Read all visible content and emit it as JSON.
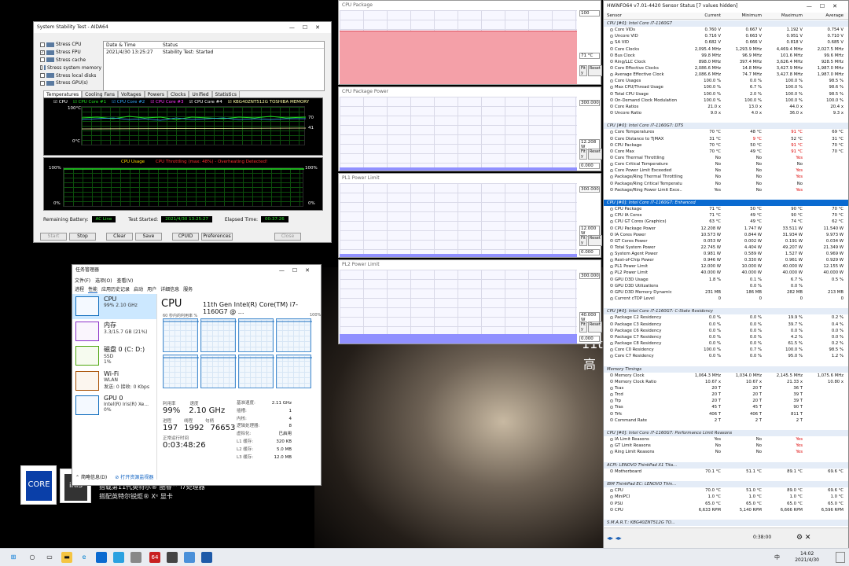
{
  "desktop": {
    "promo_line1": "11th",
    "promo_line2": "高",
    "caption1": "搭载第11代英特尔® 酷睿™ i7处理器",
    "caption2": "搭配英特尔锐炬® Xᵉ 显卡",
    "badge_core": "CORE",
    "badge_iris": "iRIS"
  },
  "aida": {
    "title": "System Stability Test - AIDA64",
    "options": [
      {
        "label": "Stress CPU",
        "checked": false
      },
      {
        "label": "Stress FPU",
        "checked": true
      },
      {
        "label": "Stress cache",
        "checked": false
      },
      {
        "label": "Stress system memory",
        "checked": false
      },
      {
        "label": "Stress local disks",
        "checked": false
      },
      {
        "label": "Stress GPU(s)",
        "checked": false
      }
    ],
    "log_headers": [
      "Date & Time",
      "Status"
    ],
    "log_rows": [
      [
        "2021/4/30 13:25:27",
        "Stability Test: Started"
      ]
    ],
    "tabs": [
      "Temperatures",
      "Cooling Fans",
      "Voltages",
      "Powers",
      "Clocks",
      "Unified",
      "Statistics"
    ],
    "legend": [
      "CPU",
      "CPU Core #1",
      "CPU Core #2",
      "CPU Core #3",
      "CPU Core #4",
      "KBG40ZNT512G TOSHIBA MEMORY"
    ],
    "legend_colors": [
      "#ffffff",
      "#22dd22",
      "#33aaff",
      "#ff33ff",
      "#ffffff",
      "#ffffaa"
    ],
    "temp_top": "100°C",
    "temp_bottom": "0°C",
    "temp_r1": "70",
    "temp_r2": "41",
    "usage_title": "CPU Usage",
    "throttle_text": "CPU Throttling (max: 48%) - Overheating Detected!",
    "usage_top_l": "100%",
    "usage_top_r": "100%",
    "usage_bot_l": "0%",
    "usage_bot_r": "0%",
    "remaining_label": "Remaining Battery:",
    "remaining_value": "AC Line",
    "started_label": "Test Started:",
    "started_value": "2021/4/30 13:25:27",
    "elapsed_label": "Elapsed Time:",
    "elapsed_value": "00:37:26",
    "buttons": [
      "Start",
      "Stop",
      "Clear",
      "Save",
      "CPUID",
      "Preferences",
      "Close"
    ]
  },
  "taskmgr": {
    "title": "任务管理器",
    "menu": [
      "文件(F)",
      "选项(O)",
      "查看(V)"
    ],
    "tabs": [
      "进程",
      "性能",
      "应用历史记录",
      "启动",
      "用户",
      "详细信息",
      "服务"
    ],
    "side": [
      {
        "name": "CPU",
        "detail1": "99% 2.10 GHz",
        "detail2": ""
      },
      {
        "name": "内存",
        "detail1": "3.3/15.7 GB (21%)",
        "detail2": ""
      },
      {
        "name": "磁盘 0 (C: D:)",
        "detail1": "SSD",
        "detail2": "1%"
      },
      {
        "name": "Wi-Fi",
        "detail1": "WLAN",
        "detail2": "发送: 0 接收: 0 Kbps"
      },
      {
        "name": "GPU 0",
        "detail1": "Intel(R) Iris(R) Xe...",
        "detail2": "0%"
      }
    ],
    "heading": "CPU",
    "cpu_name": "11th Gen Intel(R) Core(TM) i7-1160G7 @ ...",
    "graph_label": "60 秒内的利用率 %",
    "graph_max": "100%",
    "stat_labels1": [
      "利用率",
      "速度"
    ],
    "stat_values1": [
      "99%",
      "2.10 GHz"
    ],
    "stat_labels2": [
      "进程",
      "线程",
      "句柄"
    ],
    "stat_values2": [
      "197",
      "1992",
      "76653"
    ],
    "uptime_label": "正常运行时间",
    "uptime": "0:03:48:26",
    "specs": [
      [
        "基准速度:",
        "2.11 GHz"
      ],
      [
        "插槽:",
        "1"
      ],
      [
        "内核:",
        "4"
      ],
      [
        "逻辑处理器:",
        "8"
      ],
      [
        "虚拟化:",
        "已启用"
      ],
      [
        "L1 缓存:",
        "320 KB"
      ],
      [
        "L2 缓存:",
        "5.0 MB"
      ],
      [
        "L3 缓存:",
        "12.0 MB"
      ]
    ],
    "footer_less": "简略信息(D)",
    "footer_monitor": "打开资源监视器"
  },
  "graphs": [
    {
      "title": "CPU Package",
      "max": "100",
      "current": "71 °C",
      "zero": "0",
      "fill": "#f4a0a8",
      "level": 0.72
    },
    {
      "title": "CPU Package Power",
      "max": "300.000",
      "current": "12.208 W",
      "zero": "0.000",
      "fill": "#9090ff",
      "level": 0.04
    },
    {
      "title": "PL1 Power Limit",
      "max": "300.000",
      "current": "12.000 W",
      "zero": "0.000",
      "fill": "#9090ff",
      "level": 0.04
    },
    {
      "title": "PL2 Power Limit",
      "max": "300.000",
      "current": "40.000 W",
      "zero": "0.000",
      "fill": "#9090ff",
      "level": 0.133
    }
  ],
  "graph_buttons": [
    "Fit y",
    "Reset"
  ],
  "hwinfo": {
    "title": "HWiNFO64 v7.01-4420 Sensor Status [7 values hidden]",
    "headers": [
      "Sensor",
      "Current",
      "Minimum",
      "Maximum",
      "Average"
    ],
    "rows": [
      {
        "t": "g",
        "name": "CPU [#0]: Intel Core i7-1160G7"
      },
      {
        "name": "Core VIDs",
        "v": [
          "0.760 V",
          "0.667 V",
          "1.192 V",
          "0.754 V"
        ]
      },
      {
        "name": "Uncore VID",
        "v": [
          "0.716 V",
          "0.663 V",
          "0.951 V",
          "0.710 V"
        ]
      },
      {
        "name": "SA VID",
        "v": [
          "0.682 V",
          "0.666 V",
          "0.818 V",
          "0.685 V"
        ]
      },
      {
        "name": "Core Clocks",
        "v": [
          "2,095.4 MHz",
          "1,293.9 MHz",
          "4,469.4 MHz",
          "2,027.5 MHz"
        ]
      },
      {
        "name": "Bus Clock",
        "v": [
          "99.8 MHz",
          "96.9 MHz",
          "101.6 MHz",
          "99.6 MHz"
        ]
      },
      {
        "name": "Ring/LLC Clock",
        "v": [
          "898.0 MHz",
          "397.4 MHz",
          "3,626.4 MHz",
          "928.5 MHz"
        ]
      },
      {
        "name": "Core Effective Clocks",
        "v": [
          "2,086.6 MHz",
          "14.8 MHz",
          "3,427.9 MHz",
          "1,987.0 MHz"
        ]
      },
      {
        "name": "Average Effective Clock",
        "v": [
          "2,086.6 MHz",
          "74.7 MHz",
          "3,427.8 MHz",
          "1,987.0 MHz"
        ]
      },
      {
        "name": "Core Usages",
        "v": [
          "100.0 %",
          "0.0 %",
          "100.0 %",
          "98.5 %"
        ]
      },
      {
        "name": "Max CPU/Thread Usage",
        "v": [
          "100.0 %",
          "6.7 %",
          "100.0 %",
          "98.6 %"
        ]
      },
      {
        "name": "Total CPU Usage",
        "v": [
          "100.0 %",
          "2.0 %",
          "100.0 %",
          "98.5 %"
        ]
      },
      {
        "name": "On-Demand Clock Modulation",
        "v": [
          "100.0 %",
          "100.0 %",
          "100.0 %",
          "100.0 %"
        ]
      },
      {
        "name": "Core Ratios",
        "v": [
          "21.0 x",
          "13.0 x",
          "44.0 x",
          "20.4 x"
        ]
      },
      {
        "name": "Uncore Ratio",
        "v": [
          "9.0 x",
          "4.0 x",
          "36.0 x",
          "9.3 x"
        ]
      },
      {
        "t": "s"
      },
      {
        "t": "g",
        "name": "CPU [#0]: Intel Core i7-1160G7: DTS"
      },
      {
        "name": "Core Temperatures",
        "v": [
          "70 °C",
          "48 °C",
          "91 °C",
          "69 °C"
        ],
        "red": [
          2
        ]
      },
      {
        "name": "Core Distance to TjMAX",
        "v": [
          "31 °C",
          "9 °C",
          "52 °C",
          "31 °C"
        ],
        "red": [
          1
        ]
      },
      {
        "name": "CPU Package",
        "v": [
          "70 °C",
          "50 °C",
          "91 °C",
          "70 °C"
        ],
        "red": [
          2
        ]
      },
      {
        "name": "Core Max",
        "v": [
          "70 °C",
          "49 °C",
          "91 °C",
          "70 °C"
        ],
        "red": [
          2
        ]
      },
      {
        "name": "Core Thermal Throttling",
        "v": [
          "No",
          "No",
          "Yes",
          ""
        ],
        "red": [
          2
        ]
      },
      {
        "name": "Core Critical Temperature",
        "v": [
          "No",
          "No",
          "No",
          ""
        ]
      },
      {
        "name": "Core Power Limit Exceeded",
        "v": [
          "No",
          "No",
          "Yes",
          ""
        ],
        "red": [
          2
        ]
      },
      {
        "name": "Package/Ring Thermal Throttling",
        "v": [
          "No",
          "No",
          "Yes",
          ""
        ],
        "red": [
          2
        ]
      },
      {
        "name": "Package/Ring Critical Temperature",
        "v": [
          "No",
          "No",
          "No",
          ""
        ]
      },
      {
        "name": "Package/Ring Power Limit Exce...",
        "v": [
          "Yes",
          "No",
          "Yes",
          ""
        ],
        "red": [
          2
        ]
      },
      {
        "t": "s"
      },
      {
        "t": "g",
        "sel": true,
        "name": "CPU [#0]: Intel Core i7-1160G7: Enhanced"
      },
      {
        "name": "CPU Package",
        "v": [
          "71 °C",
          "50 °C",
          "90 °C",
          "70 °C"
        ]
      },
      {
        "name": "CPU IA Cores",
        "v": [
          "71 °C",
          "49 °C",
          "90 °C",
          "70 °C"
        ]
      },
      {
        "name": "CPU GT Cores (Graphics)",
        "v": [
          "63 °C",
          "49 °C",
          "74 °C",
          "62 °C"
        ]
      },
      {
        "name": "CPU Package Power",
        "v": [
          "12.208 W",
          "1.747 W",
          "33.511 W",
          "11.540 W"
        ]
      },
      {
        "name": "IA Cores Power",
        "v": [
          "10.573 W",
          "0.844 W",
          "31.934 W",
          "9.973 W"
        ]
      },
      {
        "name": "GT Cores Power",
        "v": [
          "0.053 W",
          "0.002 W",
          "0.191 W",
          "0.034 W"
        ]
      },
      {
        "name": "Total System Power",
        "v": [
          "22.745 W",
          "4.404 W",
          "49.207 W",
          "21.349 W"
        ]
      },
      {
        "name": "System Agent Power",
        "v": [
          "0.981 W",
          "0.589 W",
          "1.527 W",
          "0.969 W"
        ]
      },
      {
        "name": "Rest-of-Chip Power",
        "v": [
          "0.946 W",
          "0.330 W",
          "0.961 W",
          "0.929 W"
        ]
      },
      {
        "name": "PL1 Power Limit",
        "v": [
          "12.000 W",
          "10.000 W",
          "40.000 W",
          "12.155 W"
        ]
      },
      {
        "name": "PL2 Power Limit",
        "v": [
          "40.000 W",
          "40.000 W",
          "40.000 W",
          "40.000 W"
        ]
      },
      {
        "name": "GPU D3D Usage",
        "v": [
          "1.8 %",
          "0.1 %",
          "6.7 %",
          "0.5 %"
        ]
      },
      {
        "name": "GPU D3D Utilizations",
        "v": [
          "",
          "0.0 %",
          "0.0 %",
          ""
        ]
      },
      {
        "name": "GPU D3D Memory Dynamic",
        "v": [
          "231 MB",
          "186 MB",
          "282 MB",
          "213 MB"
        ]
      },
      {
        "name": "Current cTDP Level",
        "v": [
          "0",
          "0",
          "0",
          "0"
        ]
      },
      {
        "t": "s"
      },
      {
        "t": "g",
        "name": "CPU [#0]: Intel Core i7-1160G7: C-State Residency"
      },
      {
        "name": "Package C2 Residency",
        "v": [
          "0.0 %",
          "0.0 %",
          "19.9 %",
          "0.2 %"
        ]
      },
      {
        "name": "Package C3 Residency",
        "v": [
          "0.0 %",
          "0.0 %",
          "39.7 %",
          "0.4 %"
        ]
      },
      {
        "name": "Package C6 Residency",
        "v": [
          "0.0 %",
          "0.0 %",
          "0.0 %",
          "0.0 %"
        ]
      },
      {
        "name": "Package C7 Residency",
        "v": [
          "0.0 %",
          "0.0 %",
          "4.2 %",
          "0.0 %"
        ]
      },
      {
        "name": "Package C8 Residency",
        "v": [
          "0.0 %",
          "0.0 %",
          "61.5 %",
          "0.2 %"
        ]
      },
      {
        "name": "Core C0 Residency",
        "v": [
          "100.0 %",
          "0.7 %",
          "100.0 %",
          "98.5 %"
        ]
      },
      {
        "name": "Core C7 Residency",
        "v": [
          "0.0 %",
          "0.0 %",
          "95.0 %",
          "1.2 %"
        ]
      },
      {
        "t": "s"
      },
      {
        "t": "g",
        "name": "Memory Timings"
      },
      {
        "name": "Memory Clock",
        "v": [
          "1,064.3 MHz",
          "1,034.0 MHz",
          "2,145.5 MHz",
          "1,075.6 MHz"
        ]
      },
      {
        "name": "Memory Clock Ratio",
        "v": [
          "10.67 x",
          "10.67 x",
          "21.33 x",
          "10.80 x"
        ]
      },
      {
        "name": "Tcas",
        "v": [
          "20 T",
          "20 T",
          "36 T",
          ""
        ]
      },
      {
        "name": "Trcd",
        "v": [
          "20 T",
          "20 T",
          "39 T",
          ""
        ]
      },
      {
        "name": "Trp",
        "v": [
          "20 T",
          "20 T",
          "39 T",
          ""
        ]
      },
      {
        "name": "Tras",
        "v": [
          "45 T",
          "45 T",
          "90 T",
          ""
        ]
      },
      {
        "name": "Trfc",
        "v": [
          "406 T",
          "406 T",
          "811 T",
          ""
        ]
      },
      {
        "name": "Command Rate",
        "v": [
          "2 T",
          "2 T",
          "2 T",
          ""
        ]
      },
      {
        "t": "s"
      },
      {
        "t": "g",
        "name": "CPU [#0]: Intel Core i7-1160G7: Performance Limit Reasons"
      },
      {
        "name": "IA Limit Reasons",
        "v": [
          "Yes",
          "No",
          "Yes",
          ""
        ],
        "red": [
          2
        ]
      },
      {
        "name": "GT Limit Reasons",
        "v": [
          "No",
          "No",
          "Yes",
          ""
        ],
        "red": [
          2
        ]
      },
      {
        "name": "Ring Limit Reasons",
        "v": [
          "No",
          "No",
          "Yes",
          ""
        ],
        "red": [
          2
        ]
      },
      {
        "t": "s"
      },
      {
        "t": "g",
        "name": "ACPI: LENOVO ThinkPad X1 Tita..."
      },
      {
        "name": "Motherboard",
        "v": [
          "70.1 °C",
          "51.1 °C",
          "89.1 °C",
          "69.6 °C"
        ]
      },
      {
        "t": "s"
      },
      {
        "t": "g",
        "name": "IBM ThinkPad EC: LENOVO Thin..."
      },
      {
        "name": "CPU",
        "v": [
          "70.0 °C",
          "51.0 °C",
          "89.0 °C",
          "69.6 °C"
        ]
      },
      {
        "name": "MiniPCI",
        "v": [
          "1.0 °C",
          "1.0 °C",
          "1.0 °C",
          "1.0 °C"
        ]
      },
      {
        "name": "PSU",
        "v": [
          "65.0 °C",
          "65.0 °C",
          "65.0 °C",
          "65.0 °C"
        ]
      },
      {
        "name": "CPU",
        "v": [
          "6,633 RPM",
          "5,140 RPM",
          "6,666 RPM",
          "6,596 RPM"
        ]
      },
      {
        "t": "s"
      },
      {
        "t": "g",
        "name": "S.M.A.R.T.: KBG40ZNT512G TO..."
      }
    ],
    "foot_time": "0:38:00"
  },
  "taskbar": {
    "time": "14:02",
    "date": "2021/4/30",
    "aida_badge": "64",
    "ime": "中"
  }
}
